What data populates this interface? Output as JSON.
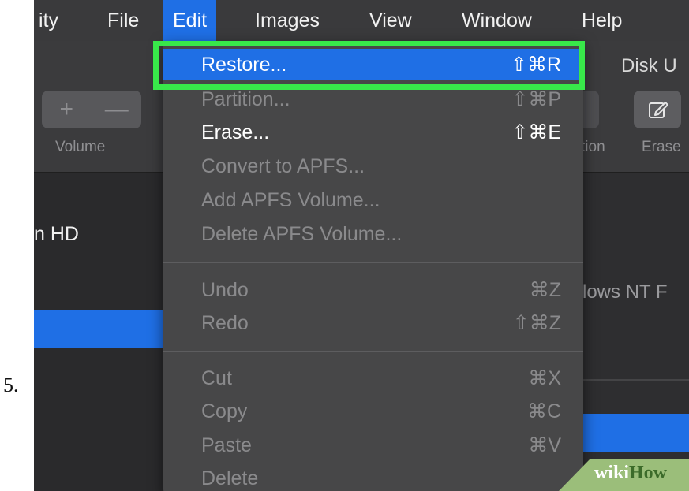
{
  "step": {
    "number": "5."
  },
  "menubar": {
    "items": [
      {
        "label": "ity"
      },
      {
        "label": "File"
      },
      {
        "label": "Edit"
      },
      {
        "label": "Images"
      },
      {
        "label": "View"
      },
      {
        "label": "Window"
      },
      {
        "label": "Help"
      }
    ]
  },
  "window": {
    "title": "Disk U",
    "toolbar": {
      "plus": "+",
      "minus": "—",
      "volume_label": "Volume",
      "partition_label": "tion",
      "erase_label": "Erase"
    },
    "sidebar": {
      "item": "n HD"
    },
    "main": {
      "format_text": "lows NT F"
    }
  },
  "edit_menu": {
    "items": [
      {
        "label": "Restore...",
        "shortcut": "⇧⌘R"
      },
      {
        "label": "Partition...",
        "shortcut": "⇧⌘P"
      },
      {
        "label": "Erase...",
        "shortcut": "⇧⌘E"
      },
      {
        "label": "Convert to APFS...",
        "shortcut": ""
      },
      {
        "label": "Add APFS Volume...",
        "shortcut": ""
      },
      {
        "label": "Delete APFS Volume...",
        "shortcut": ""
      },
      {
        "label": "Undo",
        "shortcut": "⌘Z"
      },
      {
        "label": "Redo",
        "shortcut": "⇧⌘Z"
      },
      {
        "label": "Cut",
        "shortcut": "⌘X"
      },
      {
        "label": "Copy",
        "shortcut": "⌘C"
      },
      {
        "label": "Paste",
        "shortcut": "⌘V"
      },
      {
        "label": "Delete",
        "shortcut": ""
      }
    ]
  },
  "watermark": {
    "part1": "wiki",
    "part2": "How"
  },
  "colors": {
    "highlight": "#1f6fe5",
    "callout_box": "#38e84a",
    "menu_bg": "#474748",
    "menubar_bg": "#3a3a3c"
  }
}
